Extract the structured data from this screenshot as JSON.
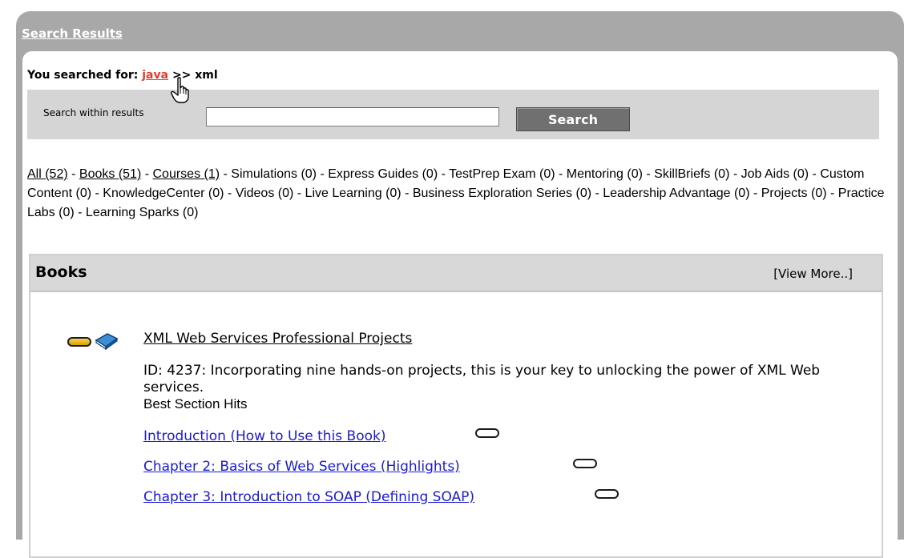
{
  "panel": {
    "title": "Search Results"
  },
  "search": {
    "prefix": "You searched for:",
    "term_link": "java",
    "suffix": ">> xml",
    "within_label": "Search within results",
    "within_value": "",
    "button_label": "Search"
  },
  "categories": [
    {
      "label": "All (52)",
      "link": true
    },
    {
      "label": "Books (51)",
      "link": true
    },
    {
      "label": "Courses (1)",
      "link": true
    },
    {
      "label": "Simulations (0)",
      "link": false
    },
    {
      "label": "Express Guides (0)",
      "link": false
    },
    {
      "label": "TestPrep Exam (0)",
      "link": false
    },
    {
      "label": "Mentoring (0)",
      "link": false
    },
    {
      "label": "SkillBriefs (0)",
      "link": false
    },
    {
      "label": "Job Aids (0)",
      "link": false
    },
    {
      "label": "Custom Content (0)",
      "link": false
    },
    {
      "label": "KnowledgeCenter (0)",
      "link": false
    },
    {
      "label": "Videos (0)",
      "link": false
    },
    {
      "label": "Live Learning (0)",
      "link": false
    },
    {
      "label": "Business Exploration Series (0)",
      "link": false
    },
    {
      "label": "Leadership Advantage (0)",
      "link": false
    },
    {
      "label": "Projects (0)",
      "link": false
    },
    {
      "label": "Practice Labs (0)",
      "link": false
    },
    {
      "label": "Learning Sparks (0)",
      "link": false
    }
  ],
  "books": {
    "heading": "Books",
    "view_more": "[View More..]",
    "result": {
      "title": "XML Web Services Professional Projects",
      "description": "ID: 4237: Incorporating nine hands-on projects, this is your key to unlocking the power of XML Web services.",
      "best_hits_label": "Best Section Hits",
      "sections": [
        "Introduction (How to Use this Book)",
        "Chapter 2: Basics of Web Services (Highlights)",
        "Chapter 3: Introduction to SOAP (Defining SOAP)"
      ]
    }
  },
  "icons": {
    "relevance": "relevance-pill-icon",
    "book": "book-icon",
    "section_relevance": "relevance-pill-outline-icon",
    "cursor": "hand-pointer-icon"
  },
  "colors": {
    "frame": "#a8a8a8",
    "search_term": "#e8392b",
    "section_link": "#1a1ad6",
    "search_button": "#707070"
  }
}
